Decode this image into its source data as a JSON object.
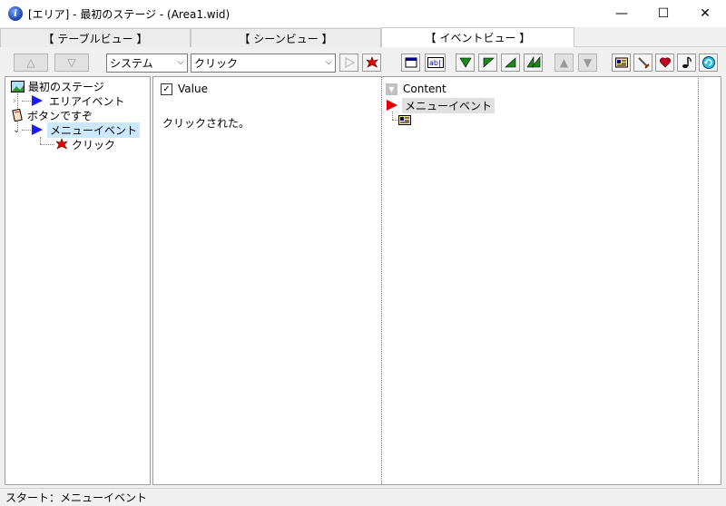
{
  "window": {
    "title": "[エリア] - 最初のステージ - (Area1.wid)",
    "controls": {
      "minimize": "—",
      "maximize": "☐",
      "close": "✕"
    }
  },
  "tabs": [
    {
      "label": "【 テーブルビュー 】",
      "active": false
    },
    {
      "label": "【 シーンビュー 】",
      "active": false
    },
    {
      "label": "【 イベントビュー 】",
      "active": true
    }
  ],
  "toolbar": {
    "up_arrow": "△",
    "down_arrow": "▽",
    "category_select": "システム",
    "event_select": "クリック",
    "move_up": "▲",
    "move_down": "▼",
    "icons": [
      "window-icon",
      "text-field-icon",
      "flag-down-left-icon",
      "flag-left-icon",
      "flag-right-icon",
      "flag-double-icon",
      "card-icon",
      "sword-icon",
      "heart-icon",
      "music-note-icon",
      "refresh-icon"
    ]
  },
  "tree": {
    "items": [
      {
        "label": "最初のステージ",
        "icon": "landscape-icon"
      },
      {
        "label": "エリアイベント",
        "icon": "blue-flag-icon"
      },
      {
        "label": "ボタンですぞ",
        "icon": "scroll-icon"
      },
      {
        "label": "メニューイベント",
        "icon": "blue-flag-icon",
        "selected": true
      },
      {
        "label": "クリック",
        "icon": "star-burst-icon"
      }
    ]
  },
  "value_panel": {
    "header": "Value",
    "checked": true,
    "text": "クリックされた。"
  },
  "content_panel": {
    "header": "Content",
    "items": [
      {
        "label": "メニューイベント",
        "icon": "red-flag-icon"
      },
      {
        "label": "",
        "icon": "card-icon"
      }
    ]
  },
  "status": {
    "text": "スタート：メニューイベント"
  },
  "colors": {
    "accent_blue": "#1a1aff",
    "accent_red": "#e00000",
    "selection": "#cce8ff"
  }
}
